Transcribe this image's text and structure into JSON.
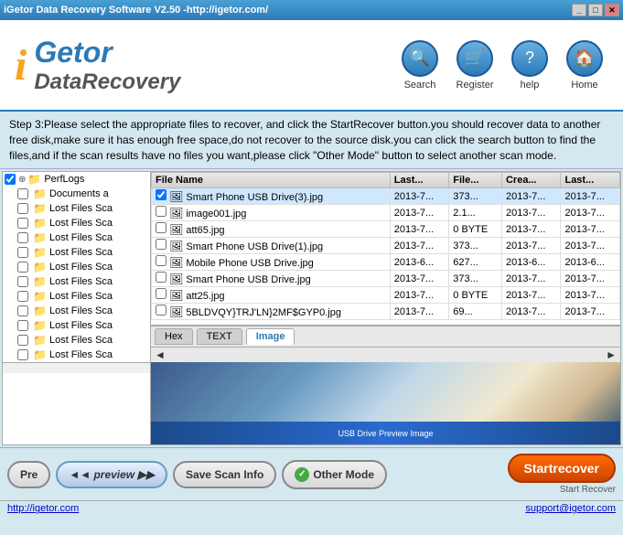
{
  "titlebar": {
    "title": "iGetor Data Recovery Software V2.50 -http://igetor.com/",
    "controls": [
      "_",
      "□",
      "✕"
    ]
  },
  "header": {
    "logo_i": "i",
    "logo_getor": "Getor",
    "logo_datarecovery": "DataRecovery",
    "nav": [
      {
        "id": "search",
        "icon": "🔍",
        "label": "Search"
      },
      {
        "id": "register",
        "icon": "🛒",
        "label": "Register"
      },
      {
        "id": "help",
        "icon": "?",
        "label": "help"
      },
      {
        "id": "home",
        "icon": "🏠",
        "label": "Home"
      }
    ]
  },
  "instruction": "Step 3:Please select the appropriate files to recover, and click the StartRecover button.you should recover data to another free disk,make sure it has enough free space,do not recover to the source disk.you can click the search button to find the files,and if the scan results have no files you want,please click \"Other Mode\" button to select another scan mode.",
  "tree": {
    "items": [
      {
        "label": "PerfLogs",
        "level": 0,
        "expanded": true
      },
      {
        "label": "Documents a",
        "level": 1
      },
      {
        "label": "Lost Files Sca",
        "level": 1
      },
      {
        "label": "Lost Files Sca",
        "level": 1
      },
      {
        "label": "Lost Files Sca",
        "level": 1
      },
      {
        "label": "Lost Files Sca",
        "level": 1
      },
      {
        "label": "Lost Files Sca",
        "level": 1
      },
      {
        "label": "Lost Files Sca",
        "level": 1
      },
      {
        "label": "Lost Files Sca",
        "level": 1
      },
      {
        "label": "Lost Files Sca",
        "level": 1
      },
      {
        "label": "Lost Files Sca",
        "level": 1
      },
      {
        "label": "Lost Files Sca",
        "level": 1
      },
      {
        "label": "Lost Files Sca",
        "level": 1
      }
    ]
  },
  "table": {
    "columns": [
      "File Name",
      "Last...",
      "File...",
      "Crea...",
      "Last..."
    ],
    "rows": [
      {
        "checked": true,
        "icon": "🖼",
        "name": "Smart Phone USB Drive(3).jpg",
        "last": "2013-7...",
        "file": "373...",
        "crea": "2013-7...",
        "last2": "2013-7...",
        "selected": true
      },
      {
        "checked": false,
        "icon": "🖼",
        "name": "image001.jpg",
        "last": "2013-7...",
        "file": "2.1...",
        "crea": "2013-7...",
        "last2": "2013-7..."
      },
      {
        "checked": false,
        "icon": "🖼",
        "name": "att65.jpg",
        "last": "2013-7...",
        "file": "0 BYTE",
        "crea": "2013-7...",
        "last2": "2013-7..."
      },
      {
        "checked": false,
        "icon": "🖼",
        "name": "Smart Phone USB Drive(1).jpg",
        "last": "2013-7...",
        "file": "373...",
        "crea": "2013-7...",
        "last2": "2013-7..."
      },
      {
        "checked": false,
        "icon": "🖼",
        "name": "Mobile Phone USB Drive.jpg",
        "last": "2013-6...",
        "file": "627...",
        "crea": "2013-6...",
        "last2": "2013-6..."
      },
      {
        "checked": false,
        "icon": "🖼",
        "name": "Smart Phone USB Drive.jpg",
        "last": "2013-7...",
        "file": "373...",
        "crea": "2013-7...",
        "last2": "2013-7..."
      },
      {
        "checked": false,
        "icon": "🖼",
        "name": "att25.jpg",
        "last": "2013-7...",
        "file": "0 BYTE",
        "crea": "2013-7...",
        "last2": "2013-7..."
      },
      {
        "checked": false,
        "icon": "🖼",
        "name": "5BLDVQY}TRJ'LN}2MF$GYP0.jpg",
        "last": "2013-7...",
        "file": "69...",
        "crea": "2013-7...",
        "last2": "2013-7..."
      }
    ]
  },
  "preview": {
    "tabs": [
      "Hex",
      "TEXT",
      "Image"
    ],
    "active_tab": "Image",
    "blue_bar_text": "USB Drive Preview Image"
  },
  "buttons": {
    "prev_label": "Pre",
    "preview_label": "preview",
    "save_scan_label": "Save Scan Info",
    "other_mode_label": "Other Mode",
    "start_label": "Startrecover",
    "start_sublabel": "Start Recover"
  },
  "statusbar": {
    "website": "http://igetor.com",
    "email": "support@igetor.com"
  }
}
